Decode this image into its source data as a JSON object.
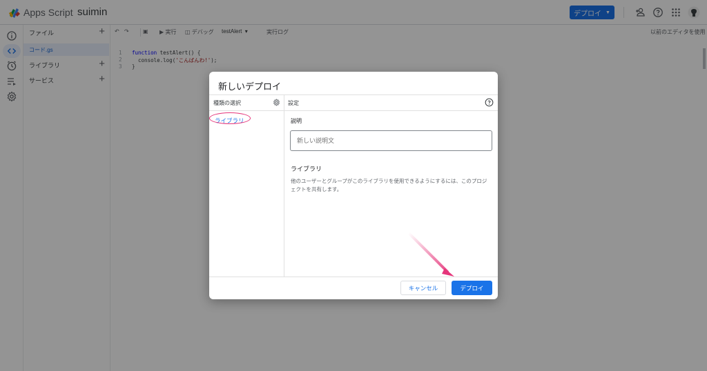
{
  "header": {
    "app_name": "Apps Script",
    "project_name": "suimin",
    "deploy_label": "デプロイ",
    "icons": [
      "add-person-icon",
      "help-icon",
      "apps-grid-icon",
      "avatar"
    ]
  },
  "rail": {
    "icons": [
      "info-icon",
      "code-icon",
      "clock-icon",
      "executions-icon",
      "settings-icon"
    ]
  },
  "files": {
    "files_label": "ファイル",
    "file_name": "コード.gs",
    "libraries_label": "ライブラリ",
    "services_label": "サービス"
  },
  "toolbar": {
    "run_label": "実行",
    "debug_label": "デバッグ",
    "function_name": "testAlert",
    "log_label": "実行ログ",
    "legacy_label": "以前のエディタを使用"
  },
  "editor": {
    "line_numbers": [
      "1",
      "2",
      "3"
    ],
    "line1_kw": "function",
    "line1_rest": " testAlert() {",
    "line2_pre": "  console.log(",
    "line2_str": "'こんばんわ!'",
    "line2_post": ");",
    "line3": "}"
  },
  "dialog": {
    "title": "新しいデプロイ",
    "type_header": "種類の選択",
    "type_option": "ライブラリ",
    "settings_header": "設定",
    "desc_label": "説明",
    "desc_placeholder": "新しい説明文",
    "lib_heading": "ライブラリ",
    "lib_text": "他のユーザーとグループがこのライブラリを使用できるようにするには、このプロジェクトを共有します。",
    "cancel_label": "キャンセル",
    "deploy_label": "デプロイ"
  },
  "colors": {
    "accent": "#1a73e8",
    "annotation": "#e5357a"
  }
}
